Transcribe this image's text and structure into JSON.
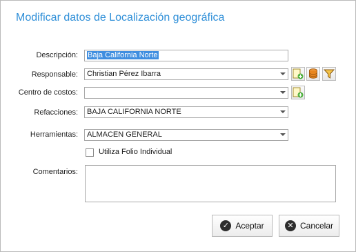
{
  "dialog": {
    "title": "Modificar datos de Localización geográfica"
  },
  "form": {
    "descripcion_label": "Descripción:",
    "descripcion_value": "Baja California Norte",
    "responsable_label": "Responsable:",
    "responsable_value": "Christian Pérez Ibarra",
    "centro_label": "Centro de costos:",
    "centro_value": "",
    "refacciones_label": "Refacciones:",
    "refacciones_value": "BAJA CALIFORNIA NORTE",
    "herramientas_label": "Herramientas:",
    "herramientas_value": "ALMACEN GENERAL",
    "folio_label": "Utiliza Folio Individual",
    "folio_checked": false,
    "comentarios_label": "Comentarios:",
    "comentarios_value": ""
  },
  "icons": {
    "add_responsable": "add-document-icon",
    "database": "database-icon",
    "filter": "filter-icon",
    "add_centro": "add-document-icon"
  },
  "buttons": {
    "accept_label": "Aceptar",
    "cancel_label": "Cancelar"
  },
  "colors": {
    "title": "#2f8fd8",
    "selection": "#3f8ee0"
  }
}
